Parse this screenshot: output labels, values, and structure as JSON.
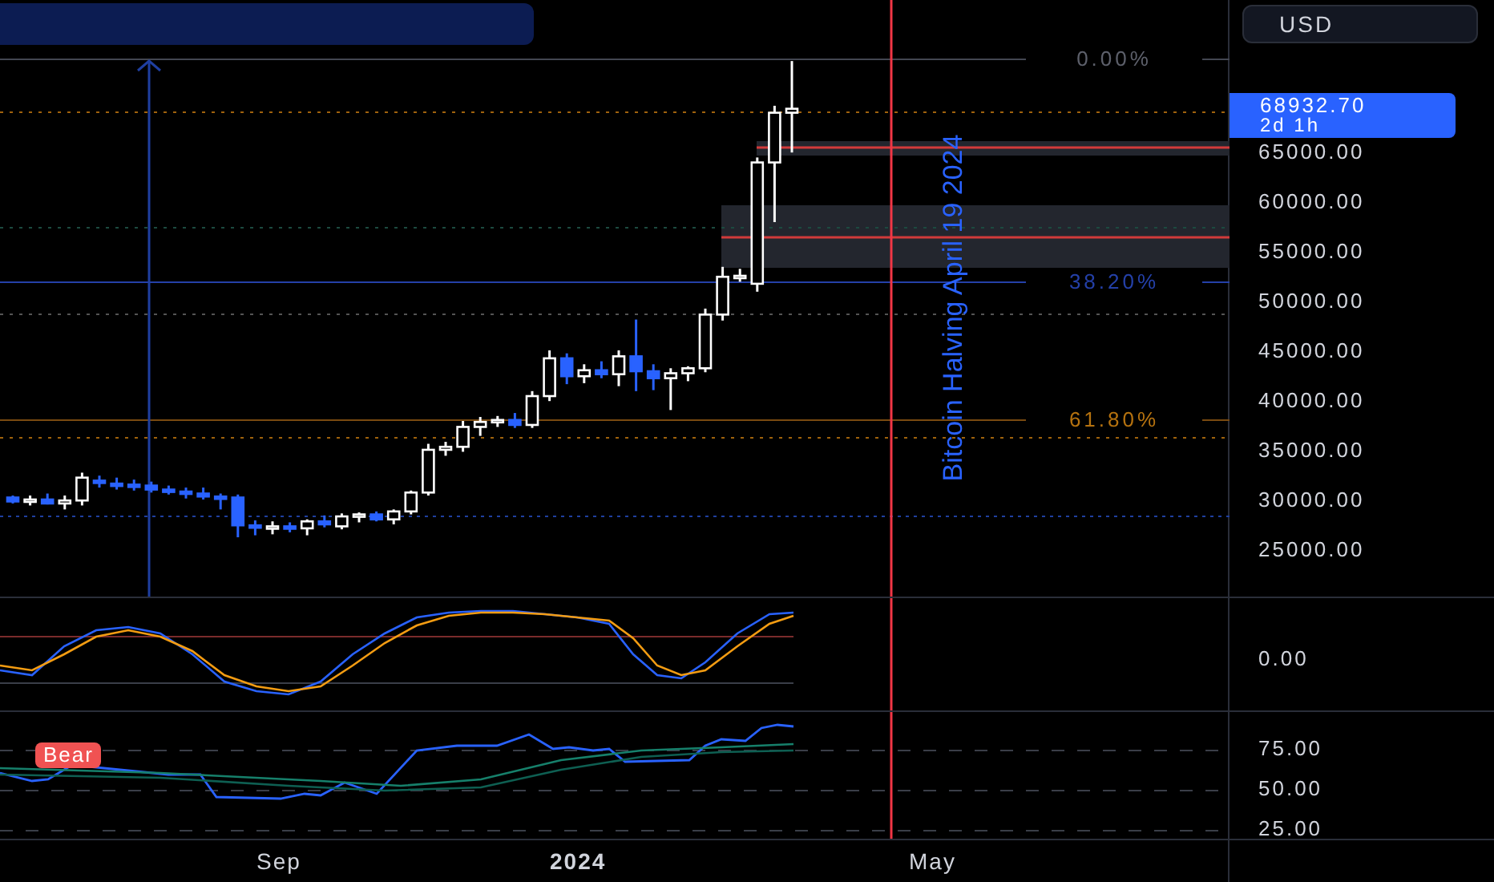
{
  "price_scale": {
    "currency_button": "USD",
    "last_price": {
      "price": "68932.70",
      "countdown": "2d 1h"
    },
    "ticks": [
      "65000.00",
      "60000.00",
      "55000.00",
      "50000.00",
      "45000.00",
      "40000.00",
      "35000.00",
      "30000.00",
      "25000.00"
    ]
  },
  "fib_levels": [
    {
      "label": "0.00%",
      "color": "#5d606b"
    },
    {
      "label": "38.20%",
      "color": "#2440a8"
    },
    {
      "label": "61.80%",
      "color": "#b5720f"
    }
  ],
  "annotation": "Bitcoin Halving April 19 2024",
  "oscillator_ticks": [
    "0.00"
  ],
  "indicator_tag": "Bear",
  "indicator_ticks": [
    "75.00",
    "50.00",
    "25.00"
  ],
  "time_axis": [
    {
      "label": "Sep",
      "bold": false
    },
    {
      "label": "2024",
      "bold": true
    },
    {
      "label": "May",
      "bold": false
    }
  ]
}
